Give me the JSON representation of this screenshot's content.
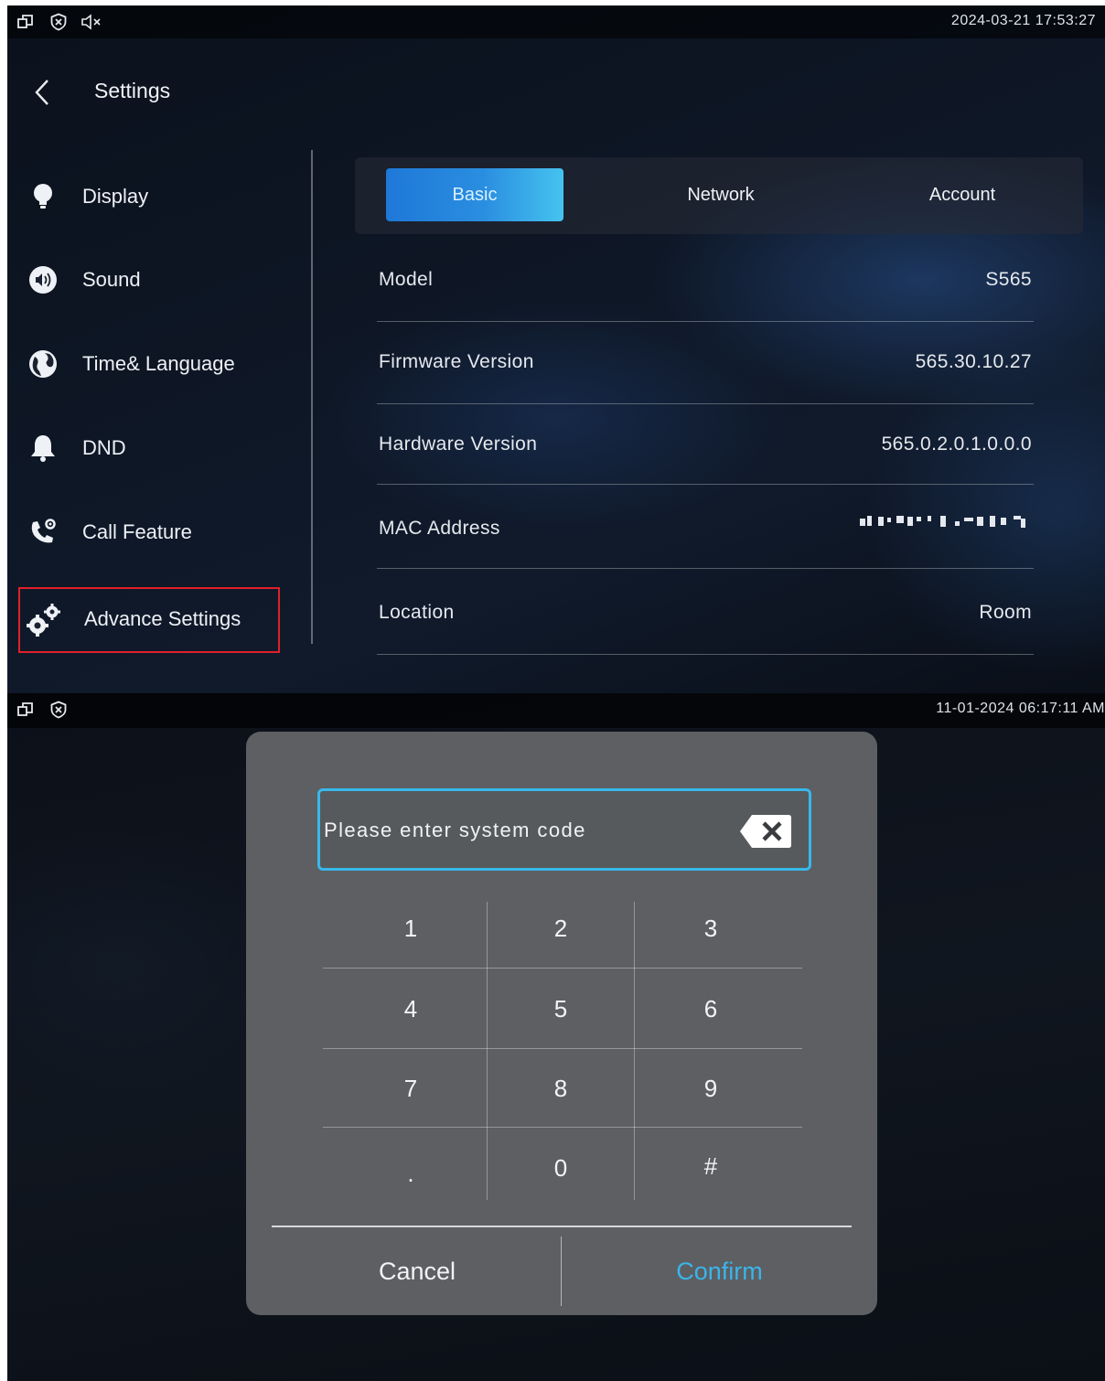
{
  "screen1": {
    "status": {
      "datetime": "2024-03-21 17:53:27",
      "icons": [
        "window-icon",
        "shield-icon",
        "mute-icon"
      ]
    },
    "header": {
      "title": "Settings"
    },
    "sidebar": {
      "items": [
        {
          "label": "Display",
          "icon": "lightbulb-icon"
        },
        {
          "label": "Sound",
          "icon": "speaker-icon"
        },
        {
          "label": "Time& Language",
          "icon": "globe-icon"
        },
        {
          "label": "DND",
          "icon": "bell-icon"
        },
        {
          "label": "Call Feature",
          "icon": "phone-gear-icon"
        },
        {
          "label": "Advance Settings",
          "icon": "gears-icon",
          "highlighted": true
        }
      ]
    },
    "tabs": [
      {
        "label": "Basic",
        "active": true
      },
      {
        "label": "Network",
        "active": false
      },
      {
        "label": "Account",
        "active": false
      }
    ],
    "info": {
      "rows": [
        {
          "key": "Model",
          "value": "S565"
        },
        {
          "key": "Firmware Version",
          "value": "565.30.10.27"
        },
        {
          "key": "Hardware Version",
          "value": "565.0.2.0.1.0.0.0"
        },
        {
          "key": "MAC Address",
          "value": ""
        },
        {
          "key": "Location",
          "value": "Room"
        }
      ]
    }
  },
  "screen2": {
    "status": {
      "datetime": "11-01-2024 06:17:11 AM",
      "icons": [
        "window-icon",
        "shield-icon"
      ]
    },
    "dialog": {
      "placeholder": "Please enter system code",
      "keys": [
        [
          "1",
          "2",
          "3"
        ],
        [
          "4",
          "5",
          "6"
        ],
        [
          "7",
          "8",
          "9"
        ],
        [
          ".",
          "0",
          "#"
        ]
      ],
      "cancel_label": "Cancel",
      "confirm_label": "Confirm"
    }
  },
  "colors": {
    "accent": "#38b8ea",
    "tab_active_start": "#1e78d8",
    "tab_active_end": "#45c3ef",
    "highlight_border": "#e0202a",
    "dialog_bg": "#5d5f62"
  }
}
